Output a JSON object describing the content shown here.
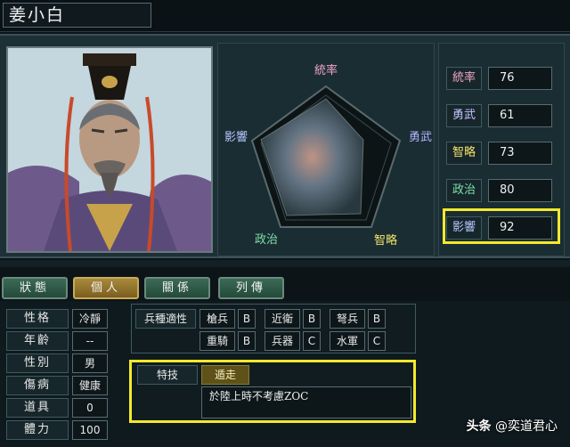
{
  "officer": {
    "name": "姜小白"
  },
  "radar": {
    "labels": [
      "統率",
      "勇武",
      "智略",
      "政治",
      "影響"
    ],
    "colors": {
      "top": "#f2a4c8",
      "right": "#b7b4ff",
      "bottom_right": "#f2e26a",
      "bottom_left": "#7fe0a8",
      "left": "#b7c8ff"
    }
  },
  "stats": [
    {
      "label": "統率",
      "value": "76",
      "color": "#f2a4c8"
    },
    {
      "label": "勇武",
      "value": "61",
      "color": "#c8c4ff"
    },
    {
      "label": "智略",
      "value": "73",
      "color": "#f2e26a"
    },
    {
      "label": "政治",
      "value": "80",
      "color": "#7fe0a8"
    },
    {
      "label": "影響",
      "value": "92",
      "color": "#b7c8ff"
    }
  ],
  "tabs": [
    {
      "label": "狀態",
      "active": false
    },
    {
      "label": "個人",
      "active": true
    },
    {
      "label": "關係",
      "active": false
    },
    {
      "label": "列傳",
      "active": false
    }
  ],
  "personal": [
    {
      "label": "性格",
      "value": "冷靜"
    },
    {
      "label": "年齡",
      "value": "--"
    },
    {
      "label": "性別",
      "value": "男"
    },
    {
      "label": "傷病",
      "value": "健康"
    },
    {
      "label": "道具",
      "value": "0"
    },
    {
      "label": "體力",
      "value": "100"
    }
  ],
  "troops": {
    "title": "兵種適性",
    "items": [
      {
        "name": "槍兵",
        "grade": "B"
      },
      {
        "name": "近衛",
        "grade": "B"
      },
      {
        "name": "弩兵",
        "grade": "B"
      },
      {
        "name": "重騎",
        "grade": "B"
      },
      {
        "name": "兵器",
        "grade": "C"
      },
      {
        "name": "水軍",
        "grade": "C"
      }
    ]
  },
  "skill": {
    "label": "特技",
    "name": "遁走",
    "description": "於陸上時不考慮ZOC"
  },
  "watermark": {
    "prefix": "头条",
    "handle": "@奕道君心"
  }
}
